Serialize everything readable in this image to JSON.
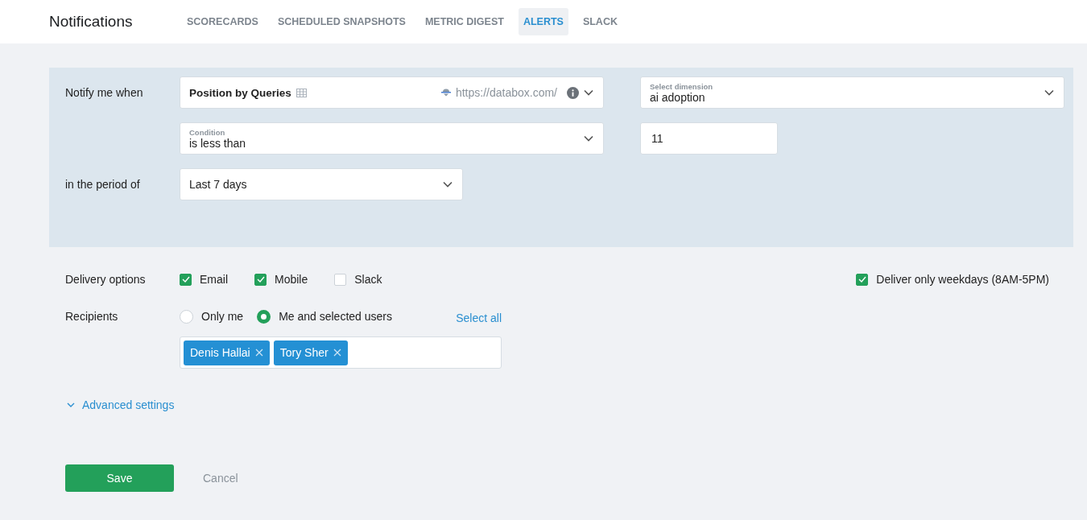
{
  "header": {
    "title": "Notifications"
  },
  "tabs": [
    {
      "label": "SCORECARDS",
      "selected": false
    },
    {
      "label": "SCHEDULED SNAPSHOTS",
      "selected": false
    },
    {
      "label": "METRIC DIGEST",
      "selected": false
    },
    {
      "label": "ALERTS",
      "selected": true
    },
    {
      "label": "SLACK",
      "selected": false
    }
  ],
  "condition_panel": {
    "notify_label": "Notify me when",
    "metric": {
      "name": "Position by Queries",
      "source": "https://databox.com/"
    },
    "dimension": {
      "placeholder": "Select dimension",
      "value": "ai adoption"
    },
    "condition": {
      "placeholder": "Condition",
      "value": "is less than"
    },
    "threshold": {
      "value": "11"
    },
    "period_label": "in the period of",
    "period": {
      "value": "Last 7 days"
    }
  },
  "delivery": {
    "label": "Delivery options",
    "options": [
      {
        "label": "Email",
        "checked": true
      },
      {
        "label": "Mobile",
        "checked": true
      },
      {
        "label": "Slack",
        "checked": false
      }
    ],
    "weekdays": {
      "label": "Deliver only weekdays (8AM-5PM)",
      "checked": true
    }
  },
  "recipients": {
    "label": "Recipients",
    "options": [
      {
        "label": "Only me",
        "selected": false
      },
      {
        "label": "Me and selected users",
        "selected": true
      }
    ],
    "select_all": "Select all",
    "users": [
      {
        "name": "Denis Hallai"
      },
      {
        "name": "Tory Sher"
      }
    ]
  },
  "advanced": {
    "label": "Advanced settings",
    "expanded": false
  },
  "buttons": {
    "save": "Save",
    "cancel": "Cancel"
  }
}
